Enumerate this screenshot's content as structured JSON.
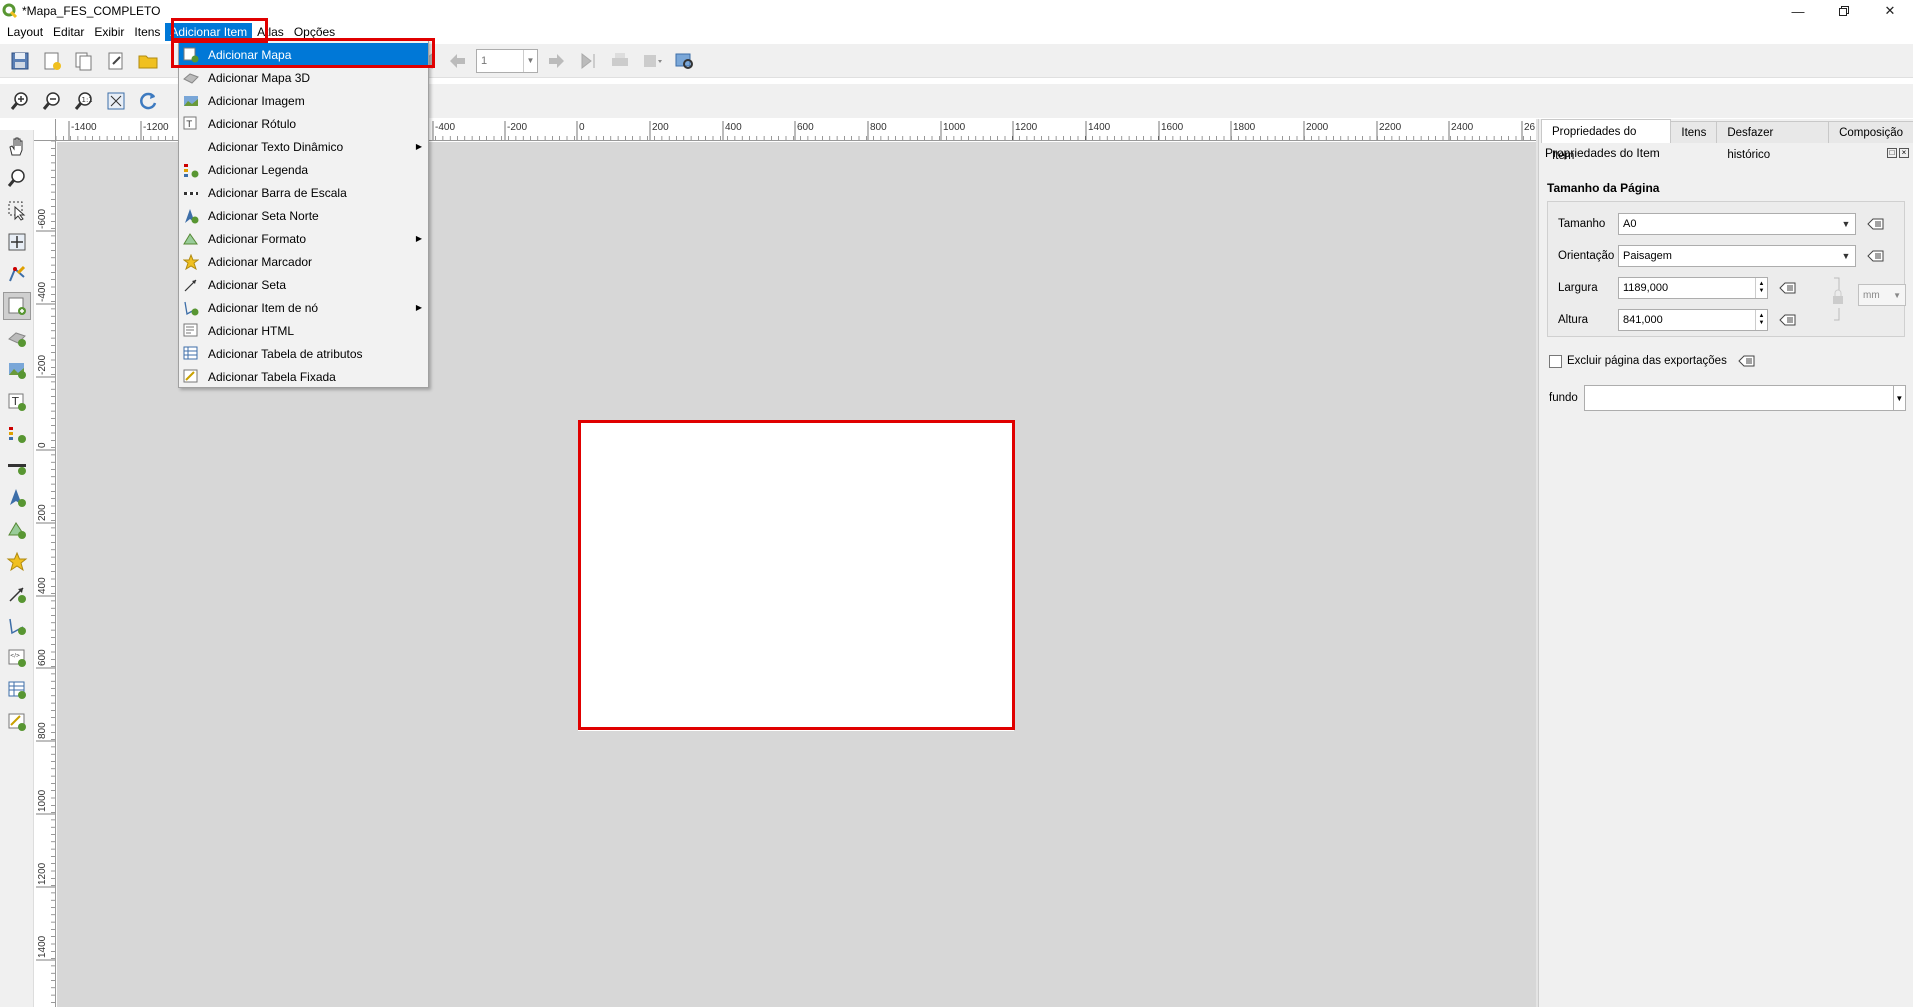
{
  "window": {
    "title": "*Mapa_FES_COMPLETO",
    "controls": [
      "minimize",
      "restore",
      "close"
    ]
  },
  "menubar": {
    "items": [
      {
        "label": "Layout"
      },
      {
        "label": "Editar"
      },
      {
        "label": "Exibir"
      },
      {
        "label": "Itens"
      },
      {
        "label": "Adicionar Item"
      },
      {
        "label": "Atlas"
      },
      {
        "label": "Opções"
      }
    ],
    "active_item": "Adicionar Item"
  },
  "atlas_toolbar": {
    "page_value": "1"
  },
  "dropdown": {
    "items": [
      {
        "label": "Adicionar Mapa",
        "icon": "add-map-icon",
        "selected": true,
        "submenu": false
      },
      {
        "label": "Adicionar Mapa 3D",
        "icon": "add-3d-map-icon",
        "selected": false,
        "submenu": false
      },
      {
        "label": "Adicionar Imagem",
        "icon": "add-image-icon",
        "selected": false,
        "submenu": false
      },
      {
        "label": "Adicionar Rótulo",
        "icon": "add-label-icon",
        "selected": false,
        "submenu": false
      },
      {
        "label": "Adicionar Texto Dinâmico",
        "icon": "",
        "selected": false,
        "submenu": true
      },
      {
        "label": "Adicionar Legenda",
        "icon": "add-legend-icon",
        "selected": false,
        "submenu": false
      },
      {
        "label": "Adicionar Barra de Escala",
        "icon": "add-scalebar-icon",
        "selected": false,
        "submenu": false
      },
      {
        "label": "Adicionar Seta Norte",
        "icon": "add-north-arrow-icon",
        "selected": false,
        "submenu": false
      },
      {
        "label": "Adicionar Formato",
        "icon": "add-shape-icon",
        "selected": false,
        "submenu": true
      },
      {
        "label": "Adicionar Marcador",
        "icon": "add-marker-icon",
        "selected": false,
        "submenu": false
      },
      {
        "label": "Adicionar Seta",
        "icon": "add-arrow-icon",
        "selected": false,
        "submenu": false
      },
      {
        "label": "Adicionar Item de nó",
        "icon": "add-node-item-icon",
        "selected": false,
        "submenu": true
      },
      {
        "label": "Adicionar HTML",
        "icon": "add-html-icon",
        "selected": false,
        "submenu": false
      },
      {
        "label": "Adicionar Tabela de atributos",
        "icon": "add-attribute-table-icon",
        "selected": false,
        "submenu": false
      },
      {
        "label": "Adicionar Tabela Fixada",
        "icon": "add-fixed-table-icon",
        "selected": false,
        "submenu": false
      }
    ]
  },
  "ruler": {
    "h_labels": [
      "-1400",
      "-1200",
      "-400",
      "-200",
      "0",
      "200",
      "400",
      "600",
      "800",
      "1000",
      "1200",
      "1400",
      "1600",
      "1800",
      "2000",
      "2200",
      "2400",
      "26"
    ],
    "v_labels": [
      "-600",
      "-400",
      "-200",
      "0",
      "200",
      "400",
      "600",
      "800",
      "1000",
      "1200",
      "1400"
    ]
  },
  "right_panel": {
    "tabs": [
      "Propriedades do Item",
      "Itens",
      "Desfazer histórico",
      "Composição"
    ],
    "active_tab": "Propriedades do Item",
    "header": "Propriedades do Item",
    "page_size": {
      "title": "Tamanho da Página",
      "size_label": "Tamanho",
      "size_value": "A0",
      "orientation_label": "Orientação",
      "orientation_value": "Paisagem",
      "width_label": "Largura",
      "width_value": "1189,000",
      "height_label": "Altura",
      "height_value": "841,000",
      "unit": "mm"
    },
    "exclude_label": "Excluir página das exportações",
    "exclude_checked": false,
    "fundo_label": "fundo"
  },
  "colors": {
    "highlight_red": "#e00000",
    "selection_blue": "#0078d7",
    "canvas_gray": "#d7d7d7",
    "qgis_green": "#589632"
  }
}
